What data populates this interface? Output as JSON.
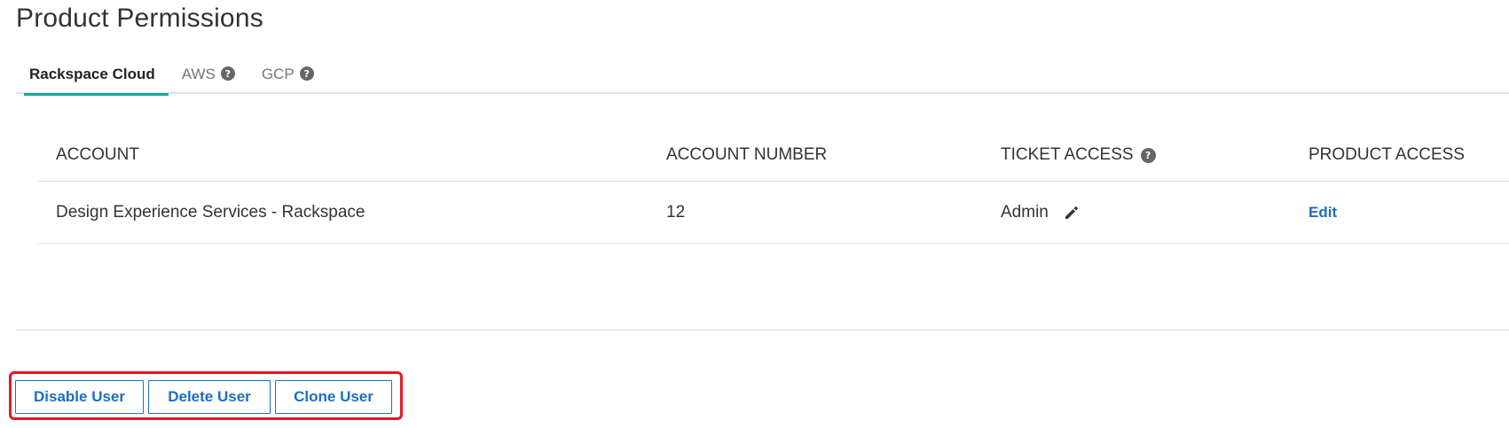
{
  "page": {
    "title": "Product Permissions"
  },
  "tabs": [
    {
      "label": "Rackspace Cloud",
      "active": true,
      "help": false
    },
    {
      "label": "AWS",
      "active": false,
      "help": true,
      "icon": "question-circle-icon"
    },
    {
      "label": "GCP",
      "active": false,
      "help": true,
      "icon": "question-circle-icon"
    }
  ],
  "table": {
    "headers": {
      "account": "ACCOUNT",
      "account_number": "ACCOUNT NUMBER",
      "ticket_access": "TICKET ACCESS",
      "product_access": "PRODUCT ACCESS"
    },
    "rows": [
      {
        "account": "Design Experience Services - Rackspace",
        "account_number": "12",
        "ticket_access": "Admin",
        "product_access": "Edit"
      }
    ]
  },
  "actions": {
    "disable_label": "Disable User",
    "delete_label": "Delete User",
    "clone_label": "Clone User"
  },
  "colors": {
    "accent_tab": "#1aa69b",
    "link": "#1b6ec2",
    "highlight_outline": "#e31b23"
  },
  "icons": {
    "help": "question-circle-icon",
    "edit": "pencil-icon"
  }
}
